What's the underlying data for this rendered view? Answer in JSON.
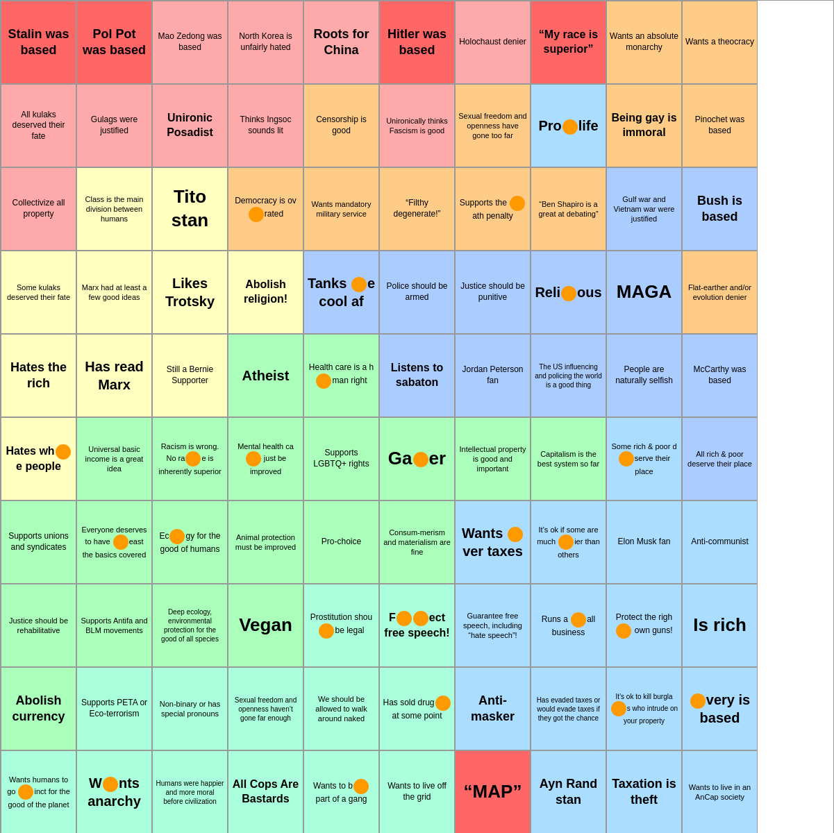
{
  "cells": [
    {
      "id": "r0c0",
      "text": "Stalin was based",
      "size": "xlarge",
      "color": "red"
    },
    {
      "id": "r0c1",
      "text": "Pol Pot was based",
      "size": "xlarge",
      "color": "red"
    },
    {
      "id": "r0c2",
      "text": "Mao Zedong was based",
      "size": "normal",
      "color": "light-red"
    },
    {
      "id": "r0c3",
      "text": "North Korea is unfairly hated",
      "size": "normal",
      "color": "light-red"
    },
    {
      "id": "r0c4",
      "text": "Roots for China",
      "size": "xlarge",
      "color": "light-red"
    },
    {
      "id": "r0c5",
      "text": "Hitler was based",
      "size": "xlarge",
      "color": "red"
    },
    {
      "id": "r0c6",
      "text": "Holochaust denier",
      "size": "normal",
      "color": "light-red"
    },
    {
      "id": "r0c7",
      "text": "“My race is superior”",
      "size": "large",
      "color": "red"
    },
    {
      "id": "r0c8",
      "text": "Wants an absolute monarchy",
      "size": "normal",
      "color": "orange"
    },
    {
      "id": "r0c9",
      "text": "Wants a theocracy",
      "size": "normal",
      "color": "orange"
    },
    {
      "id": "r0c10",
      "text": "",
      "size": "normal",
      "color": "white"
    },
    {
      "id": "r1c0",
      "text": "All kulaks deserved their fate",
      "size": "normal",
      "color": "light-red"
    },
    {
      "id": "r1c1",
      "text": "Gulags were justified",
      "size": "normal",
      "color": "light-red"
    },
    {
      "id": "r1c2",
      "text": "Unironic Posadist",
      "size": "large",
      "color": "light-red"
    },
    {
      "id": "r1c3",
      "text": "Thinks Ingsoc sounds lit",
      "size": "normal",
      "color": "light-red"
    },
    {
      "id": "r1c4",
      "text": "Censorship is good",
      "size": "normal",
      "color": "orange"
    },
    {
      "id": "r1c5",
      "text": "Unironically thinks Fascism is good",
      "size": "normal",
      "color": "light-red"
    },
    {
      "id": "r1c6",
      "text": "Sexual freedom and openness have gone too far",
      "size": "normal",
      "color": "orange",
      "dot": true
    },
    {
      "id": "r1c7",
      "text": "Pro•life",
      "size": "large",
      "color": "cyan",
      "dot": true
    },
    {
      "id": "r1c8",
      "text": "Being gay is immoral",
      "size": "large",
      "color": "orange"
    },
    {
      "id": "r1c9",
      "text": "Pinochet was based",
      "size": "normal",
      "color": "orange"
    },
    {
      "id": "r1c10",
      "text": "",
      "size": "normal",
      "color": "white"
    },
    {
      "id": "r2c0",
      "text": "Collectivize all property",
      "size": "normal",
      "color": "light-red"
    },
    {
      "id": "r2c1",
      "text": "Class is the main division between humans",
      "size": "normal",
      "color": "light-yellow"
    },
    {
      "id": "r2c2",
      "text": "Tito stan",
      "size": "xlarge",
      "color": "light-yellow"
    },
    {
      "id": "r2c3",
      "text": "Democracy is ov•rated",
      "size": "normal",
      "color": "orange",
      "dot": true
    },
    {
      "id": "r2c4",
      "text": "Wants mandatory military service",
      "size": "normal",
      "color": "orange"
    },
    {
      "id": "r2c5",
      "text": "“Filthy degenerate!”",
      "size": "normal",
      "color": "orange"
    },
    {
      "id": "r2c6",
      "text": "Supports the •ath penalty",
      "size": "normal",
      "color": "orange",
      "dot": true
    },
    {
      "id": "r2c7",
      "text": "“Ben Shapiro is a great at debating”",
      "size": "normal",
      "color": "orange"
    },
    {
      "id": "r2c8",
      "text": "Gulf war and Vietnam war were justified",
      "size": "normal",
      "color": "light-blue"
    },
    {
      "id": "r2c9",
      "text": "Bush is based",
      "size": "xlarge",
      "color": "light-blue"
    },
    {
      "id": "r2c10",
      "text": "",
      "size": "normal",
      "color": "white"
    },
    {
      "id": "r3c0",
      "text": "Some kulaks deserved their fate",
      "size": "normal",
      "color": "light-yellow"
    },
    {
      "id": "r3c1",
      "text": "Marx had at least a few good ideas",
      "size": "normal",
      "color": "light-yellow"
    },
    {
      "id": "r3c2",
      "text": "Likes Trotsky",
      "size": "large",
      "color": "light-yellow"
    },
    {
      "id": "r3c3",
      "text": "Abolish religion!",
      "size": "large",
      "color": "light-yellow"
    },
    {
      "id": "r3c4",
      "text": "Tanks •e cool af",
      "size": "large",
      "color": "light-blue",
      "dot": true
    },
    {
      "id": "r3c5",
      "text": "Police should be armed",
      "size": "normal",
      "color": "light-blue"
    },
    {
      "id": "r3c6",
      "text": "Justice should be punitive",
      "size": "normal",
      "color": "light-blue"
    },
    {
      "id": "r3c7",
      "text": "Reli•ous",
      "size": "large",
      "color": "light-blue",
      "dot": true
    },
    {
      "id": "r3c8",
      "text": "MAGA",
      "size": "xlarge",
      "color": "light-blue"
    },
    {
      "id": "r3c9",
      "text": "Flat-earther and/or evolution denier",
      "size": "normal",
      "color": "orange"
    },
    {
      "id": "r3c10",
      "text": "",
      "size": "normal",
      "color": "white"
    },
    {
      "id": "r4c0",
      "text": "Hates the rich",
      "size": "xlarge",
      "color": "light-yellow"
    },
    {
      "id": "r4c1",
      "text": "Has read Marx",
      "size": "large",
      "color": "light-yellow"
    },
    {
      "id": "r4c2",
      "text": "Still a Bernie Supporter",
      "size": "normal",
      "color": "light-yellow"
    },
    {
      "id": "r4c3",
      "text": "Atheist",
      "size": "large",
      "color": "light-green"
    },
    {
      "id": "r4c4",
      "text": "Health care is a h•man right",
      "size": "normal",
      "color": "light-green",
      "dot": true
    },
    {
      "id": "r4c5",
      "text": "Listens to sabaton",
      "size": "large",
      "color": "light-blue"
    },
    {
      "id": "r4c6",
      "text": "Jordan Peterson fan",
      "size": "normal",
      "color": "light-blue"
    },
    {
      "id": "r4c7",
      "text": "The US influencing and policing the world is a good thing",
      "size": "normal",
      "color": "light-blue"
    },
    {
      "id": "r4c8",
      "text": "People are naturally selfish",
      "size": "normal",
      "color": "light-blue"
    },
    {
      "id": "r4c9",
      "text": "McCarthy was based",
      "size": "normal",
      "color": "light-blue"
    },
    {
      "id": "r4c10",
      "text": "",
      "size": "normal",
      "color": "white"
    },
    {
      "id": "r5c0",
      "text": "Hates wh•e people",
      "size": "large",
      "color": "light-yellow",
      "dot": true
    },
    {
      "id": "r5c1",
      "text": "Universal basic income is a great idea",
      "size": "normal",
      "color": "light-green"
    },
    {
      "id": "r5c2",
      "text": "Racism is wrong. No ra•e is inherently superior",
      "size": "normal",
      "color": "light-green",
      "dot": true
    },
    {
      "id": "r5c3",
      "text": "Mental health ca• just be improved",
      "size": "normal",
      "color": "light-green",
      "dot": true
    },
    {
      "id": "r5c4",
      "text": "Supports LGBTQ+ rights",
      "size": "normal",
      "color": "light-green"
    },
    {
      "id": "r5c5",
      "text": "Ga•er",
      "size": "xlarge",
      "color": "light-green",
      "dot": true
    },
    {
      "id": "r5c6",
      "text": "Intellectual property is good and important",
      "size": "normal",
      "color": "light-green"
    },
    {
      "id": "r5c7",
      "text": "Capitalism is the best system so far",
      "size": "normal",
      "color": "light-green"
    },
    {
      "id": "r5c8",
      "text": "Some rich & poor d•serve their place",
      "size": "normal",
      "color": "cyan",
      "dot": true
    },
    {
      "id": "r5c9",
      "text": "All rich & poor deserve their place",
      "size": "normal",
      "color": "light-blue"
    },
    {
      "id": "r5c10",
      "text": "",
      "size": "normal",
      "color": "white"
    },
    {
      "id": "r6c0",
      "text": "Supports unions and syndicates",
      "size": "normal",
      "color": "light-green"
    },
    {
      "id": "r6c1",
      "text": "Everyone deserves to have •east the basics covered",
      "size": "normal",
      "color": "light-green",
      "dot": true
    },
    {
      "id": "r6c2",
      "text": "Ec•gy for the good of humans",
      "size": "normal",
      "color": "light-green",
      "dot": true
    },
    {
      "id": "r6c3",
      "text": "Animal protection must be improved",
      "size": "normal",
      "color": "light-green"
    },
    {
      "id": "r6c4",
      "text": "Pro-choice",
      "size": "normal",
      "color": "light-green"
    },
    {
      "id": "r6c5",
      "text": "Consum-merism and materialism are fine",
      "size": "normal",
      "color": "light-green"
    },
    {
      "id": "r6c6",
      "text": "Wants •ver taxes",
      "size": "large",
      "color": "cyan",
      "dot": true
    },
    {
      "id": "r6c7",
      "text": "It’s ok if some are much •ier than others",
      "size": "normal",
      "color": "cyan",
      "dot": true
    },
    {
      "id": "r6c8",
      "text": "Elon Musk fan",
      "size": "normal",
      "color": "cyan"
    },
    {
      "id": "r6c9",
      "text": "Anti-communist",
      "size": "normal",
      "color": "cyan"
    },
    {
      "id": "r6c10",
      "text": "",
      "size": "normal",
      "color": "white"
    },
    {
      "id": "r7c0",
      "text": "Justice should be rehabilitative",
      "size": "normal",
      "color": "light-green"
    },
    {
      "id": "r7c1",
      "text": "Supports Antifa and BLM movements",
      "size": "normal",
      "color": "light-green"
    },
    {
      "id": "r7c2",
      "text": "Deep ecology, environmental protection for the good of all species",
      "size": "normal",
      "color": "light-green",
      "dot": true
    },
    {
      "id": "r7c3",
      "text": "Vegan",
      "size": "xlarge",
      "color": "light-green"
    },
    {
      "id": "r7c4",
      "text": "Prostitution shou•be legal",
      "size": "normal",
      "color": "teal",
      "dot": true
    },
    {
      "id": "r7c5",
      "text": "F••ect free speech!",
      "size": "large",
      "color": "teal",
      "dot": true
    },
    {
      "id": "r7c6",
      "text": "Guarantee free speech, including “hate speech”!",
      "size": "normal",
      "color": "cyan"
    },
    {
      "id": "r7c7",
      "text": "Runs a •all business",
      "size": "normal",
      "color": "cyan",
      "dot": true
    },
    {
      "id": "r7c8",
      "text": "Protect the righ• own guns!",
      "size": "normal",
      "color": "cyan",
      "dot": true
    },
    {
      "id": "r7c9",
      "text": "Is rich",
      "size": "xlarge",
      "color": "cyan"
    },
    {
      "id": "r7c10",
      "text": "",
      "size": "normal",
      "color": "white"
    },
    {
      "id": "r8c0",
      "text": "Abolish currency",
      "size": "xlarge",
      "color": "light-green"
    },
    {
      "id": "r8c1",
      "text": "Supports PETA or Eco-terrorism",
      "size": "normal",
      "color": "teal"
    },
    {
      "id": "r8c2",
      "text": "Non-binary or has special pronouns",
      "size": "normal",
      "color": "teal"
    },
    {
      "id": "r8c3",
      "text": "Sexual freedom and openness haven’t gone far enough",
      "size": "normal",
      "color": "teal"
    },
    {
      "id": "r8c4",
      "text": "We should be allowed to walk around naked",
      "size": "normal",
      "color": "teal"
    },
    {
      "id": "r8c5",
      "text": "Has sold drug• at some point",
      "size": "normal",
      "color": "teal",
      "dot": true
    },
    {
      "id": "r8c6",
      "text": "Anti-masker",
      "size": "xlarge",
      "color": "cyan"
    },
    {
      "id": "r8c7",
      "text": "Has evaded taxes or would evade taxes if they got the chance",
      "size": "normal",
      "color": "cyan"
    },
    {
      "id": "r8c8",
      "text": "It’s ok to kill burgla•s who intrude on your property",
      "size": "normal",
      "color": "cyan",
      "dot": true
    },
    {
      "id": "r8c9",
      "text": "•very is based",
      "size": "large",
      "color": "cyan",
      "dot": true
    },
    {
      "id": "r8c10",
      "text": "",
      "size": "normal",
      "color": "white"
    },
    {
      "id": "r9c0",
      "text": "Wants humans to go •inct for the good of the planet",
      "size": "normal",
      "color": "teal",
      "dot": true
    },
    {
      "id": "r9c1",
      "text": "W•nts anarchy",
      "size": "large",
      "color": "teal",
      "dot": true
    },
    {
      "id": "r9c2",
      "text": "Humans were happier and more moral before civilization",
      "size": "normal",
      "color": "teal",
      "dot": true
    },
    {
      "id": "r9c3",
      "text": "All Cops Are Bastards",
      "size": "large",
      "color": "teal"
    },
    {
      "id": "r9c4",
      "text": "Wants to b• part of a gang",
      "size": "normal",
      "color": "teal",
      "dot": true
    },
    {
      "id": "r9c5",
      "text": "Wants to live off the grid",
      "size": "normal",
      "color": "teal"
    },
    {
      "id": "r9c6",
      "text": "“MAP”",
      "size": "xlarge",
      "color": "red"
    },
    {
      "id": "r9c7",
      "text": "Ayn Rand stan",
      "size": "xlarge",
      "color": "cyan"
    },
    {
      "id": "r9c8",
      "text": "Taxation is theft",
      "size": "xlarge",
      "color": "cyan"
    },
    {
      "id": "r9c9",
      "text": "Wants to live in an AnCap society",
      "size": "normal",
      "color": "cyan"
    },
    {
      "id": "r9c10",
      "text": "",
      "size": "normal",
      "color": "white"
    }
  ]
}
